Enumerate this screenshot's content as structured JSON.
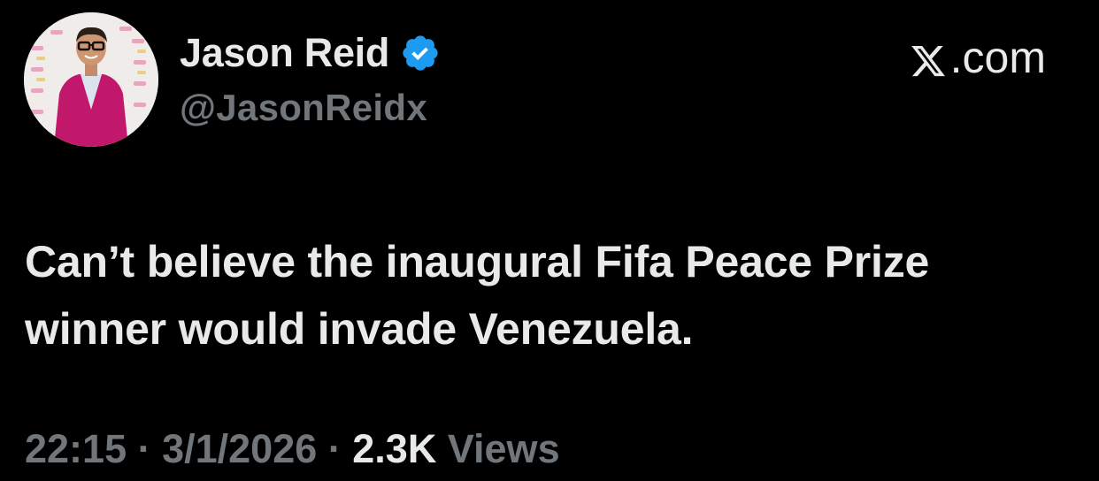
{
  "author": {
    "name": "Jason Reid",
    "handle": "@JasonReidx",
    "verified": true,
    "verified_color": "#1d9bf0"
  },
  "brand": {
    "label": ".com",
    "icon": "x-logo-icon"
  },
  "tweet": {
    "text_line1": "Can’t believe the inaugural Fifa Peace Prize",
    "text_line2": "winner would invade Venezuela."
  },
  "meta": {
    "time": "22:15",
    "separator": " · ",
    "date": "3/1/2026",
    "views_count": "2.3K",
    "views_label": " Views"
  },
  "colors": {
    "background": "#000000",
    "primary_text": "#e7e9ea",
    "secondary_text": "#71767b",
    "avatar_suit": "#c2186b"
  }
}
